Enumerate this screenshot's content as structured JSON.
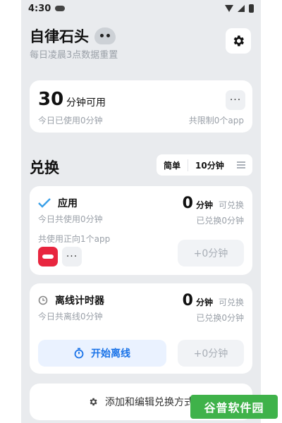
{
  "status_bar": {
    "time": "4:30"
  },
  "header": {
    "title": "自律石头",
    "subtitle": "每日凌晨3点数据重置"
  },
  "summary": {
    "minutes": "30",
    "unit_label": "分钟可用",
    "used_today": "今日已使用0分钟",
    "limit": "共限制0个app",
    "more": "···"
  },
  "exchange": {
    "section_title": "兑换",
    "mode_simple": "简单",
    "mode_duration": "10分钟",
    "apps_card": {
      "title": "应用",
      "sub": "今日共使用0分钟",
      "amount": "0",
      "amount_unit": "分钟",
      "amount_tag": "可兑换",
      "exchanged": "已兑换0分钟",
      "apps_label": "共使用正向1个app",
      "more": "···",
      "plus_button": "+0分钟"
    },
    "offline_card": {
      "title": "离线计时器",
      "sub": "今日共离线0分钟",
      "amount": "0",
      "amount_unit": "分钟",
      "amount_tag": "可兑换",
      "exchanged": "已兑换0分钟",
      "start_button": "开始离线",
      "plus_button": "+0分钟"
    },
    "add_edit": "添加和编辑兑换方式"
  },
  "watermark": "谷普软件园",
  "colors": {
    "accent": "#1a73e8",
    "check": "#3aa0e8",
    "app_icon": "#e8263f",
    "watermark": "#3fb24a"
  }
}
